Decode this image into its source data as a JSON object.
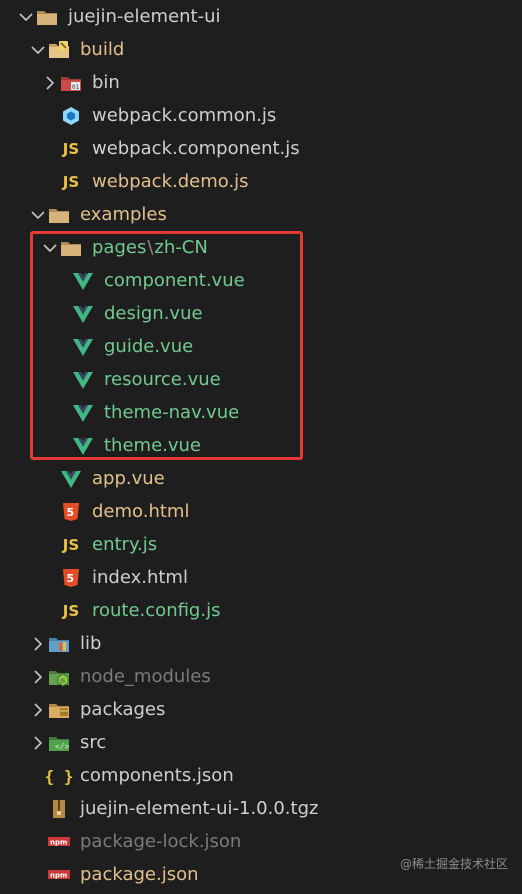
{
  "explorer": {
    "items": [
      {
        "label": "juejin-element-ui",
        "kind": "folder",
        "chevron": "down",
        "icon": "folder-icon",
        "color": "#cfcfcf"
      },
      {
        "label": "build",
        "kind": "folder",
        "chevron": "down",
        "icon": "folder-build-icon",
        "color": "#e2c08d"
      },
      {
        "label": "bin",
        "kind": "folder",
        "chevron": "right",
        "icon": "folder-bin-icon",
        "color": "#cfcfcf"
      },
      {
        "label": "webpack.common.js",
        "kind": "file",
        "icon": "webpack-icon",
        "color": "#cfcfcf"
      },
      {
        "label": "webpack.component.js",
        "kind": "file",
        "icon": "js-file-icon",
        "color": "#cfcfcf"
      },
      {
        "label": "webpack.demo.js",
        "kind": "file",
        "icon": "js-file-icon",
        "color": "#e2c08d"
      },
      {
        "label": "examples",
        "kind": "folder",
        "chevron": "down",
        "icon": "folder-icon",
        "color": "#e2c08d"
      },
      {
        "label": "pages",
        "label_suffix": "zh-CN",
        "kind": "folder",
        "chevron": "down",
        "icon": "folder-icon",
        "color": "#73c991"
      },
      {
        "label": "component.vue",
        "kind": "file",
        "icon": "vue-icon",
        "color": "#73c991"
      },
      {
        "label": "design.vue",
        "kind": "file",
        "icon": "vue-icon",
        "color": "#73c991"
      },
      {
        "label": "guide.vue",
        "kind": "file",
        "icon": "vue-icon",
        "color": "#73c991"
      },
      {
        "label": "resource.vue",
        "kind": "file",
        "icon": "vue-icon",
        "color": "#73c991"
      },
      {
        "label": "theme-nav.vue",
        "kind": "file",
        "icon": "vue-icon",
        "color": "#73c991"
      },
      {
        "label": "theme.vue",
        "kind": "file",
        "icon": "vue-icon",
        "color": "#73c991"
      },
      {
        "label": "app.vue",
        "kind": "file",
        "icon": "vue-icon",
        "color": "#e2c08d"
      },
      {
        "label": "demo.html",
        "kind": "file",
        "icon": "html-icon",
        "color": "#e2c08d"
      },
      {
        "label": "entry.js",
        "kind": "file",
        "icon": "js-file-icon",
        "color": "#73c991"
      },
      {
        "label": "index.html",
        "kind": "file",
        "icon": "html-icon",
        "color": "#cfcfcf"
      },
      {
        "label": "route.config.js",
        "kind": "file",
        "icon": "js-file-icon",
        "color": "#73c991"
      },
      {
        "label": "lib",
        "kind": "folder",
        "chevron": "right",
        "icon": "folder-lib-icon",
        "color": "#cfcfcf"
      },
      {
        "label": "node_modules",
        "kind": "folder",
        "chevron": "right",
        "icon": "folder-node-icon",
        "color": "#7b7b7b"
      },
      {
        "label": "packages",
        "kind": "folder",
        "chevron": "right",
        "icon": "folder-packages-icon",
        "color": "#cfcfcf"
      },
      {
        "label": "src",
        "kind": "folder",
        "chevron": "right",
        "icon": "folder-src-icon",
        "color": "#cfcfcf"
      },
      {
        "label": "components.json",
        "kind": "file",
        "icon": "json-icon",
        "color": "#cfcfcf"
      },
      {
        "label": "juejin-element-ui-1.0.0.tgz",
        "kind": "file",
        "icon": "archive-icon",
        "color": "#cfcfcf"
      },
      {
        "label": "package-lock.json",
        "kind": "file",
        "icon": "npm-icon",
        "color": "#7b7b7b"
      },
      {
        "label": "package.json",
        "kind": "file",
        "icon": "npm-icon",
        "color": "#e2c08d"
      }
    ]
  },
  "watermark": "@稀土掘金技术社区"
}
